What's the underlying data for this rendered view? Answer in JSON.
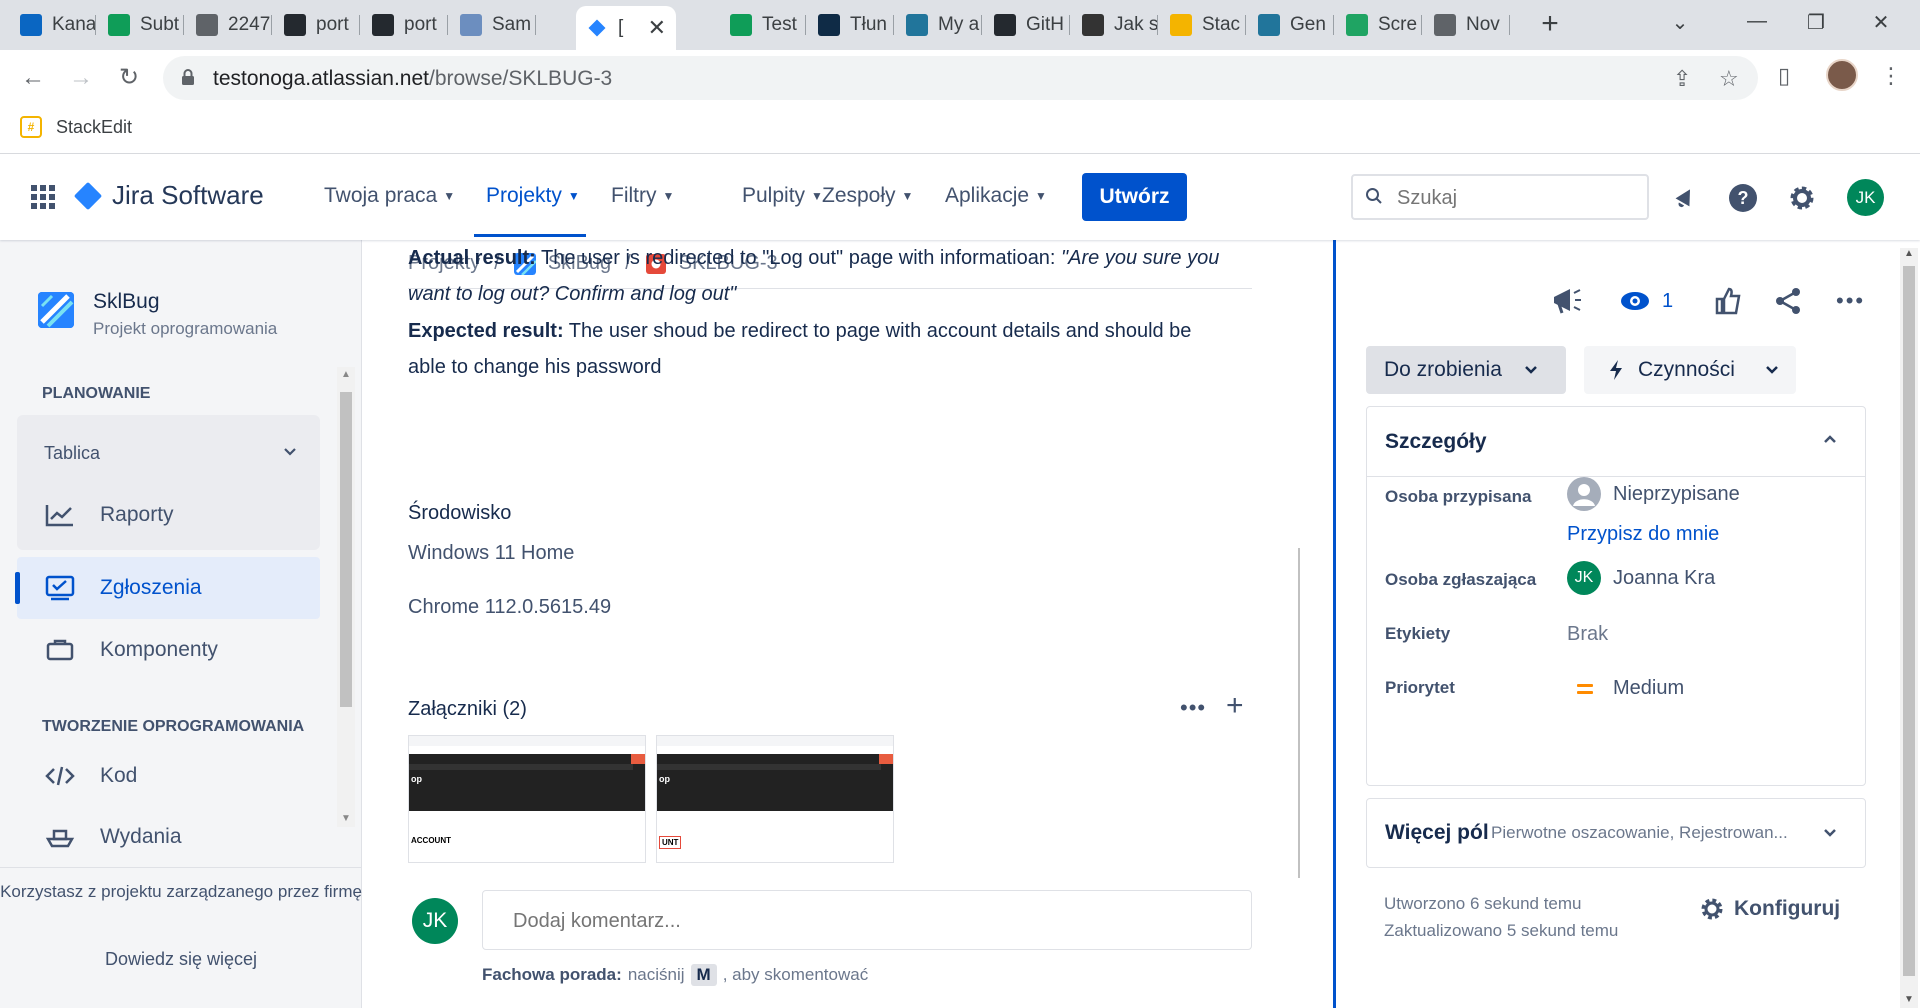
{
  "browser": {
    "tabs": [
      {
        "title": "Kana",
        "favicon": "linkedin-icon",
        "color": "#0a66c2"
      },
      {
        "title": "Subt",
        "favicon": "sheets-icon",
        "color": "#0f9d58"
      },
      {
        "title": "2247",
        "favicon": "globe-icon",
        "color": "#5f6368"
      },
      {
        "title": "port",
        "favicon": "github-icon",
        "color": "#24292f"
      },
      {
        "title": "port",
        "favicon": "github-icon",
        "color": "#24292f"
      },
      {
        "title": "Sam",
        "favicon": "sam-icon",
        "color": "#6c8ebf"
      },
      {
        "title": "[",
        "favicon": "jira-icon",
        "color": "#2684ff"
      },
      {
        "title": "Test",
        "favicon": "sheets-icon",
        "color": "#0f9d58"
      },
      {
        "title": "Tłun",
        "favicon": "deepl-icon",
        "color": "#0f2b46"
      },
      {
        "title": "My a",
        "favicon": "wordpress-icon",
        "color": "#21759b"
      },
      {
        "title": "GitH",
        "favicon": "github-icon",
        "color": "#24292f"
      },
      {
        "title": "Jak s",
        "favicon": "code-icon",
        "color": "#333"
      },
      {
        "title": "Stac",
        "favicon": "stackedit-icon",
        "color": "#f4b400"
      },
      {
        "title": "Gen",
        "favicon": "wordpress-icon",
        "color": "#21759b"
      },
      {
        "title": "Scre",
        "favicon": "drive-icon",
        "color": "#1fa463"
      },
      {
        "title": "Nov",
        "favicon": "chrome-icon",
        "color": "#5f6368"
      }
    ],
    "url_host": "testonoga.atlassian.net",
    "url_path": "/browse/SKLBUG-3",
    "bookmark_label": "StackEdit"
  },
  "jira": {
    "product": "Jira Software",
    "nav": [
      {
        "label": "Twoja praca"
      },
      {
        "label": "Projekty"
      },
      {
        "label": "Filtry"
      },
      {
        "label": "Pulpity"
      },
      {
        "label": "Zespoły"
      },
      {
        "label": "Aplikacje"
      }
    ],
    "create_label": "Utwórz",
    "search_placeholder": "Szukaj",
    "user_initials": "JK"
  },
  "sidebar": {
    "project_name": "SklBug",
    "project_type": "Projekt oprogramowania",
    "section_planning": "PLANOWANIE",
    "board_label": "Tablica",
    "reports_label": "Raporty",
    "issues_label": "Zgłoszenia",
    "components_label": "Komponenty",
    "section_dev": "TWORZENIE OPROGRAMOWANIA",
    "code_label": "Kod",
    "releases_label": "Wydania",
    "managed_text": "Korzystasz z projektu zarządzanego przez firmę",
    "learn_more": "Dowiedz się więcej"
  },
  "issue": {
    "breadcrumb": {
      "projects": "Projekty",
      "project": "SklBug",
      "key": "SKLBUG-3"
    },
    "actual_label": "Actual result:",
    "actual_text": " The user is redirected to \"Log out\" page with informatioan: ",
    "actual_quote": "\"Are you sure you want to log out? Confirm and log out\"",
    "expected_label": "Expected result:",
    "expected_text": " The user shoud be redirect to page with account details and should be able to change his password",
    "env_title": "Środowisko",
    "env_lines": [
      "Windows 11 Home",
      "Chrome 112.0.5615.49"
    ],
    "attachments_title": "Załączniki (2)",
    "attachments": [
      {
        "logo": "op",
        "title": "ACCOUNT"
      },
      {
        "logo": "op",
        "title": "UNT"
      }
    ],
    "comment_placeholder": "Dodaj komentarz...",
    "protip_label": "Fachowa porada:",
    "protip_pre": "naciśnij",
    "protip_key": "M",
    "protip_post": ", aby skomentować"
  },
  "panel": {
    "watchers_count": "1",
    "status": "Do zrobienia",
    "actions": "Czynności",
    "details_title": "Szczegóły",
    "assignee_label": "Osoba przypisana",
    "assignee_value": "Nieprzypisane",
    "assign_to_me": "Przypisz do mnie",
    "reporter_label": "Osoba zgłaszająca",
    "reporter_initials": "JK",
    "reporter_value": "Joanna Kra",
    "labels_label": "Etykiety",
    "labels_value": "Brak",
    "priority_label": "Priorytet",
    "priority_value": "Medium",
    "priority_color": "#ff8b00",
    "more_fields": "Więcej pól",
    "more_fields_sub": "Pierwotne oszacowanie, Rejestrowan...",
    "created": "Utworzono 6 sekund temu",
    "updated": "Zaktualizowano 5 sekund temu",
    "configure": "Konfiguruj"
  }
}
